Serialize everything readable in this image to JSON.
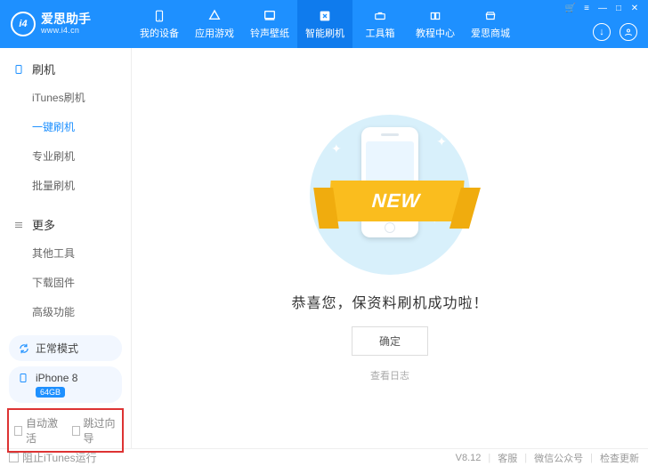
{
  "logo": {
    "badge": "i4",
    "title": "爱思助手",
    "url": "www.i4.cn"
  },
  "nav": {
    "items": [
      {
        "label": "我的设备",
        "icon": "device"
      },
      {
        "label": "应用游戏",
        "icon": "apps"
      },
      {
        "label": "铃声壁纸",
        "icon": "music"
      },
      {
        "label": "智能刷机",
        "icon": "flash",
        "active": true
      },
      {
        "label": "工具箱",
        "icon": "toolbox"
      },
      {
        "label": "教程中心",
        "icon": "book"
      },
      {
        "label": "爱思商城",
        "icon": "shop"
      }
    ]
  },
  "window_controls": {
    "cart": "🛒",
    "menu": "≡",
    "min": "—",
    "max": "□",
    "close": "✕"
  },
  "header_buttons": {
    "download": "↓",
    "user": "◯"
  },
  "sidebar": {
    "flash": {
      "title": "刷机",
      "items": [
        "iTunes刷机",
        "一键刷机",
        "专业刷机",
        "批量刷机"
      ],
      "active_index": 1
    },
    "more": {
      "title": "更多",
      "items": [
        "其他工具",
        "下载固件",
        "高级功能"
      ]
    },
    "mode": {
      "label": "正常模式"
    },
    "device": {
      "name": "iPhone 8",
      "storage": "64GB"
    },
    "opts": {
      "auto_activate": "自动激活",
      "skip_wizard": "跳过向导"
    }
  },
  "main": {
    "ribbon_text": "NEW",
    "title": "恭喜您，保资料刷机成功啦！",
    "ok_label": "确定",
    "log_link": "查看日志"
  },
  "footer": {
    "block_itunes": "阻止iTunes运行",
    "version": "V8.12",
    "links": [
      "客服",
      "微信公众号",
      "检查更新"
    ]
  }
}
